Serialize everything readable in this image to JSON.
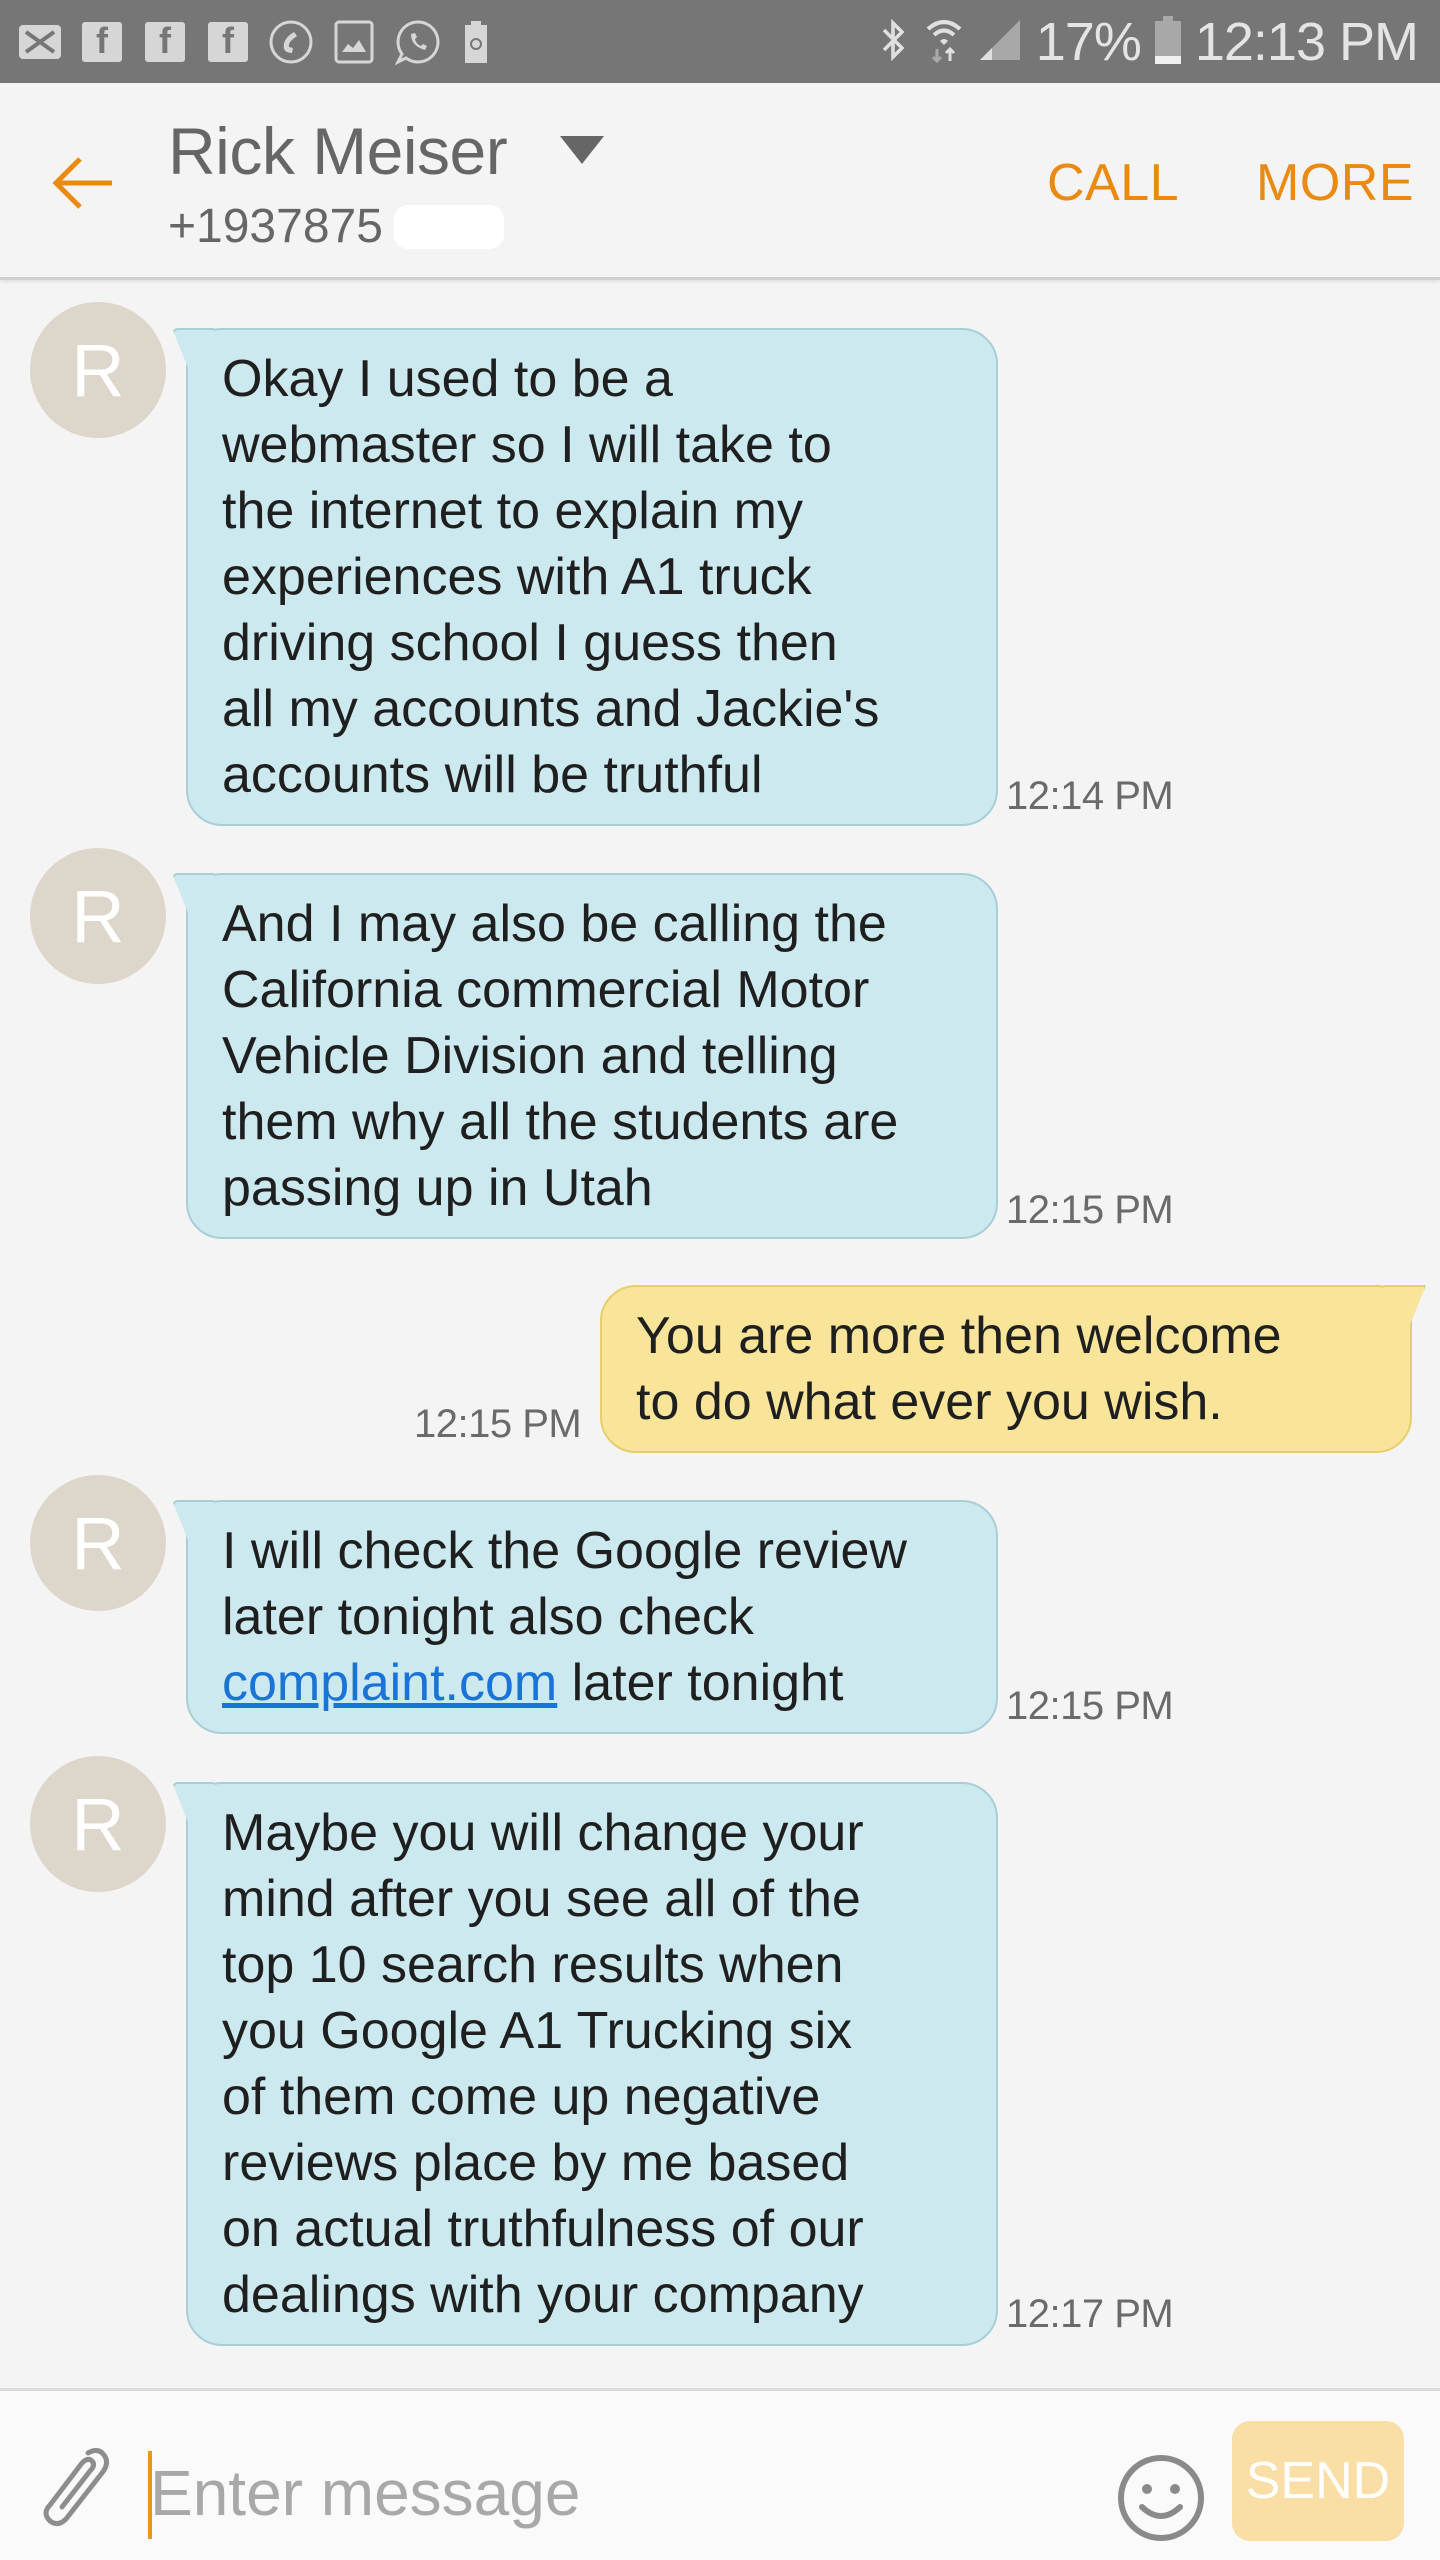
{
  "status_bar": {
    "notification_icons": [
      "email-icon",
      "facebook-icon",
      "facebook-icon",
      "facebook-icon",
      "missed-call-icon",
      "gallery-icon",
      "whatsapp-icon",
      "battery-saver-icon"
    ],
    "system_icons": [
      "bluetooth-icon",
      "wifi-icon",
      "signal-icon",
      "battery-icon"
    ],
    "battery": "17%",
    "time": "12:13 PM"
  },
  "header": {
    "contact_name": "Rick Meiser",
    "phone_number": "+1937875",
    "call_label": "CALL",
    "more_label": "MORE",
    "accent_color": "#ea8a10"
  },
  "messages": [
    {
      "direction": "incoming",
      "avatar_letter": "R",
      "lines": [
        "Okay I used to be a",
        "webmaster so I will take to",
        "the internet to explain my",
        "experiences with A1 truck",
        "driving school I guess then",
        "all my accounts and Jackie's",
        "accounts will be truthful"
      ],
      "time": "12:14 PM"
    },
    {
      "direction": "incoming",
      "avatar_letter": "R",
      "lines": [
        "And I may also be calling the",
        "California commercial Motor",
        "Vehicle Division and telling",
        "them why all the students are",
        "passing up in Utah"
      ],
      "time": "12:15 PM"
    },
    {
      "direction": "outgoing",
      "lines": [
        "You are more then welcome",
        "to do what ever you wish."
      ],
      "time": "12:15 PM"
    },
    {
      "direction": "incoming",
      "avatar_letter": "R",
      "lines": [
        "I will check the Google review",
        "later tonight also check"
      ],
      "link_text": "complaint.com",
      "after_link": " later tonight",
      "time": "12:15 PM"
    },
    {
      "direction": "incoming",
      "avatar_letter": "R",
      "lines": [
        "Maybe you will change your",
        "mind after you see all of the",
        "top 10 search results when",
        "you Google A1 Trucking six",
        "of them come up negative",
        "reviews place by me based",
        "on actual truthfulness of our",
        "dealings with your company"
      ],
      "time": "12:17 PM"
    }
  ],
  "compose": {
    "placeholder": "Enter message",
    "value": "",
    "send_label": "SEND"
  },
  "colors": {
    "incoming_bubble": "#cce9ef",
    "outgoing_bubble": "#f8e59a",
    "avatar": "#ddd6cb",
    "link": "#1a73d6",
    "send_disabled": "#f9dea5"
  }
}
